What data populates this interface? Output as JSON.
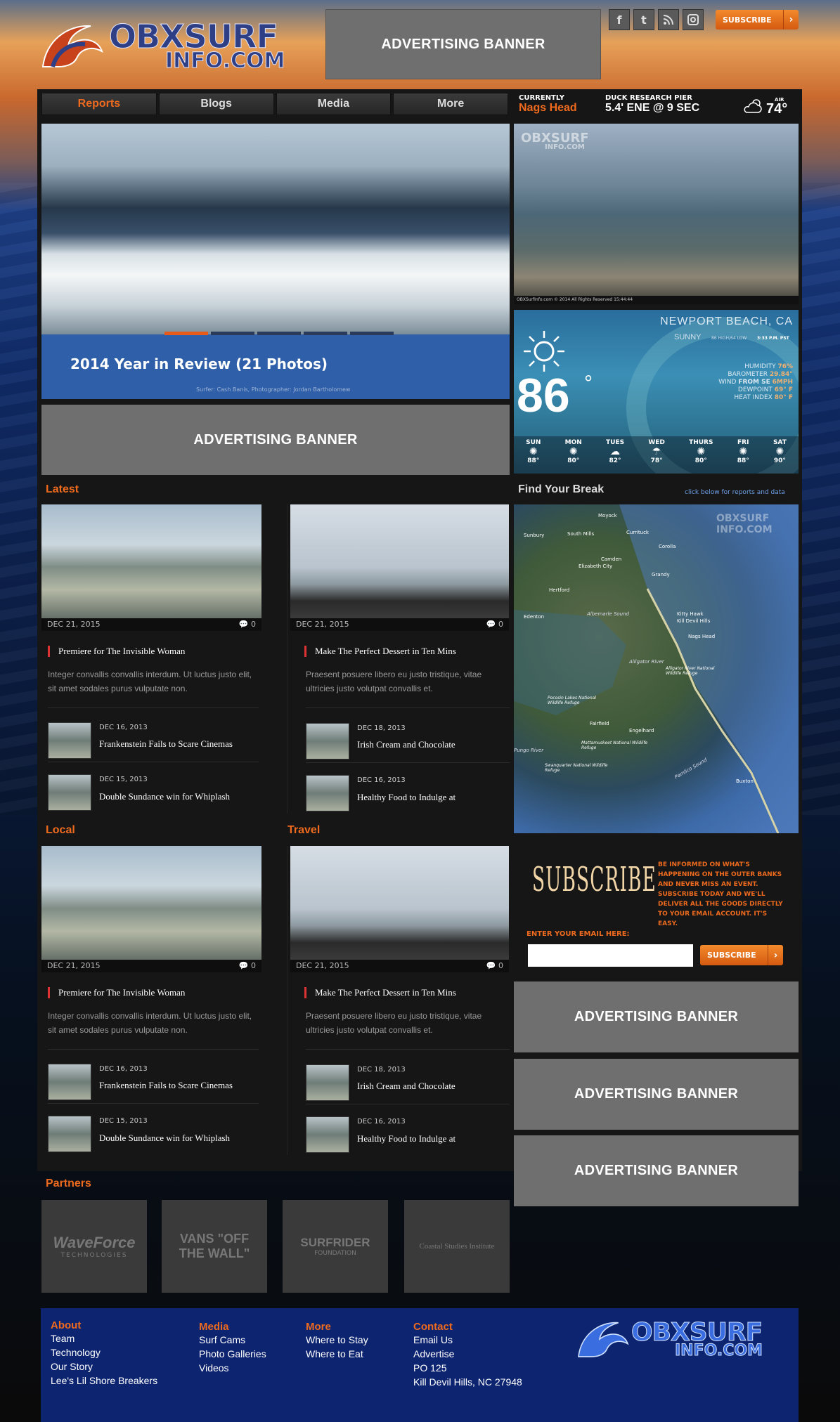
{
  "header": {
    "logo_line1": "OBXSURF",
    "logo_line2": "INFO.COM",
    "ad_label": "ADVERTISING BANNER",
    "subscribe": "SUBSCRIBE",
    "social_icons": [
      "facebook-icon",
      "twitter-icon",
      "rss-icon",
      "instagram-icon"
    ]
  },
  "nav": {
    "tabs": [
      "Reports",
      "Blogs",
      "Media",
      "More"
    ],
    "active": "Reports"
  },
  "conditions": {
    "currently_label": "CURRENTLY",
    "location": "Nags Head",
    "pier_label": "DUCK RESEARCH PIER",
    "pier_reading": "5.4' ENE @ 9 SEC",
    "air_label": "AIR",
    "air_temp": "74°"
  },
  "hero": {
    "caption": "2014 Year in Review (21 Photos)",
    "credit": "Surfer: Cash Banis, Photographer: Jordan Bartholomew",
    "slides": 5,
    "active_slide": 1
  },
  "cam": {
    "watermark_line1": "OBXSURF",
    "watermark_line2": "INFO.COM",
    "footer": "OBXSurfInfo.com © 2014 All Rights Reserved 15:44:44"
  },
  "weather": {
    "city": "NEWPORT BEACH, CA",
    "condition": "SUNNY",
    "hilo": "86 HIGH/64 LOW",
    "time": "3:33 P.M. PST",
    "temp": "86",
    "unit": "°",
    "humidity_label": "HUMIDITY",
    "humidity": "76%",
    "barometer_label": "BAROMETER",
    "barometer": "29.84\"",
    "wind_label": "WIND",
    "wind_from": "FROM SE",
    "wind_speed": "6MPH",
    "dewpoint_label": "DEWPOINT",
    "dewpoint": "69° F",
    "heat_label": "HEAT INDEX",
    "heat": "80° F",
    "forecast": [
      {
        "day": "SUN",
        "t": "88°"
      },
      {
        "day": "MON",
        "t": "80°"
      },
      {
        "day": "TUES",
        "t": "82°"
      },
      {
        "day": "WED",
        "t": "78°"
      },
      {
        "day": "THURS",
        "t": "80°"
      },
      {
        "day": "FRI",
        "t": "88°"
      },
      {
        "day": "SAT",
        "t": "90°"
      }
    ]
  },
  "ad_banner": "ADVERTISING BANNER",
  "sections": {
    "latest": "Latest",
    "local": "Local",
    "travel": "Travel",
    "partners": "Partners",
    "find_break": "Find Your Break",
    "find_hint": "click below for reports and data"
  },
  "articles": {
    "left": {
      "date": "DEC 21, 2015",
      "comments": "0",
      "title": "Premiere for The Invisible Woman",
      "body": "Integer convallis convallis interdum. Ut luctus justo elit, sit amet sodales purus vulputate non.",
      "minis": [
        {
          "date": "DEC 16, 2013",
          "title": "Frankenstein Fails to Scare Cinemas"
        },
        {
          "date": "DEC 15, 2013",
          "title": "Double Sundance win for Whiplash"
        }
      ]
    },
    "right": {
      "date": "DEC 21, 2015",
      "comments": "0",
      "title": "Make The Perfect Dessert in Ten Mins",
      "body": "Praesent posuere libero eu justo tristique, vitae ultricies justo volutpat convallis et.",
      "minis": [
        {
          "date": "DEC 18, 2013",
          "title": "Irish Cream and Chocolate"
        },
        {
          "date": "DEC 16, 2013",
          "title": "Healthy Food to Indulge at"
        }
      ]
    }
  },
  "map": {
    "labels": [
      "Moyock",
      "Sunbury",
      "South Mills",
      "Currituck",
      "Corolla",
      "Camden",
      "Elizabeth City",
      "Grandy",
      "Hertford",
      "Edenton",
      "Albemarle Sound",
      "Kitty Hawk",
      "Kill Devil Hills",
      "Nags Head",
      "Alligator River",
      "Alligator River National Wildlife Refuge",
      "Pocosin Lakes National Wildlife Refuge",
      "Fairfield",
      "Engelhard",
      "Mattamuskeet National Wildlife Refuge",
      "Swanquarter National Wildlife Refuge",
      "Pamlico Sound",
      "Buxton",
      "Pungo River"
    ],
    "watermark": "OBXSURF INFO.COM"
  },
  "subscribe": {
    "title": "SUBSCRIBE",
    "blurb": "BE INFORMED ON WHAT'S HAPPENING ON THE OUTER BANKS AND NEVER MISS AN EVENT. SUBSCRIBE TODAY AND WE'LL DELIVER ALL THE GOODS DIRECTLY TO YOUR EMAIL ACCOUNT. IT'S EASY.",
    "email_label": "ENTER YOUR EMAIL HERE:",
    "email_value": "",
    "button": "SUBSCRIBE"
  },
  "partners": [
    {
      "name": "WaveForce",
      "sub": "TECHNOLOGIES"
    },
    {
      "name": "VANS \"OFF THE WALL\""
    },
    {
      "name": "SURFRIDER",
      "sub": "FOUNDATION"
    },
    {
      "name": "Coastal Studies Institute"
    }
  ],
  "footer": {
    "about": {
      "heading": "About",
      "links": [
        "Team",
        "Technology",
        "Our Story",
        "Lee's Lil Shore Breakers"
      ]
    },
    "media": {
      "heading": "Media",
      "links": [
        "Surf Cams",
        "Photo Galleries",
        "Videos"
      ]
    },
    "more": {
      "heading": "More",
      "links": [
        "Where to Stay",
        "Where to Eat"
      ]
    },
    "contact": {
      "heading": "Contact",
      "links": [
        "Email Us",
        "Advertise",
        "PO 125",
        "Kill Devil Hills, NC 27948"
      ]
    },
    "logo_line1": "OBXSURF",
    "logo_line2": "INFO.COM"
  },
  "colors": {
    "accent": "#ee6a1e",
    "footer_bg": "#0d2470",
    "panel": "#161616"
  }
}
